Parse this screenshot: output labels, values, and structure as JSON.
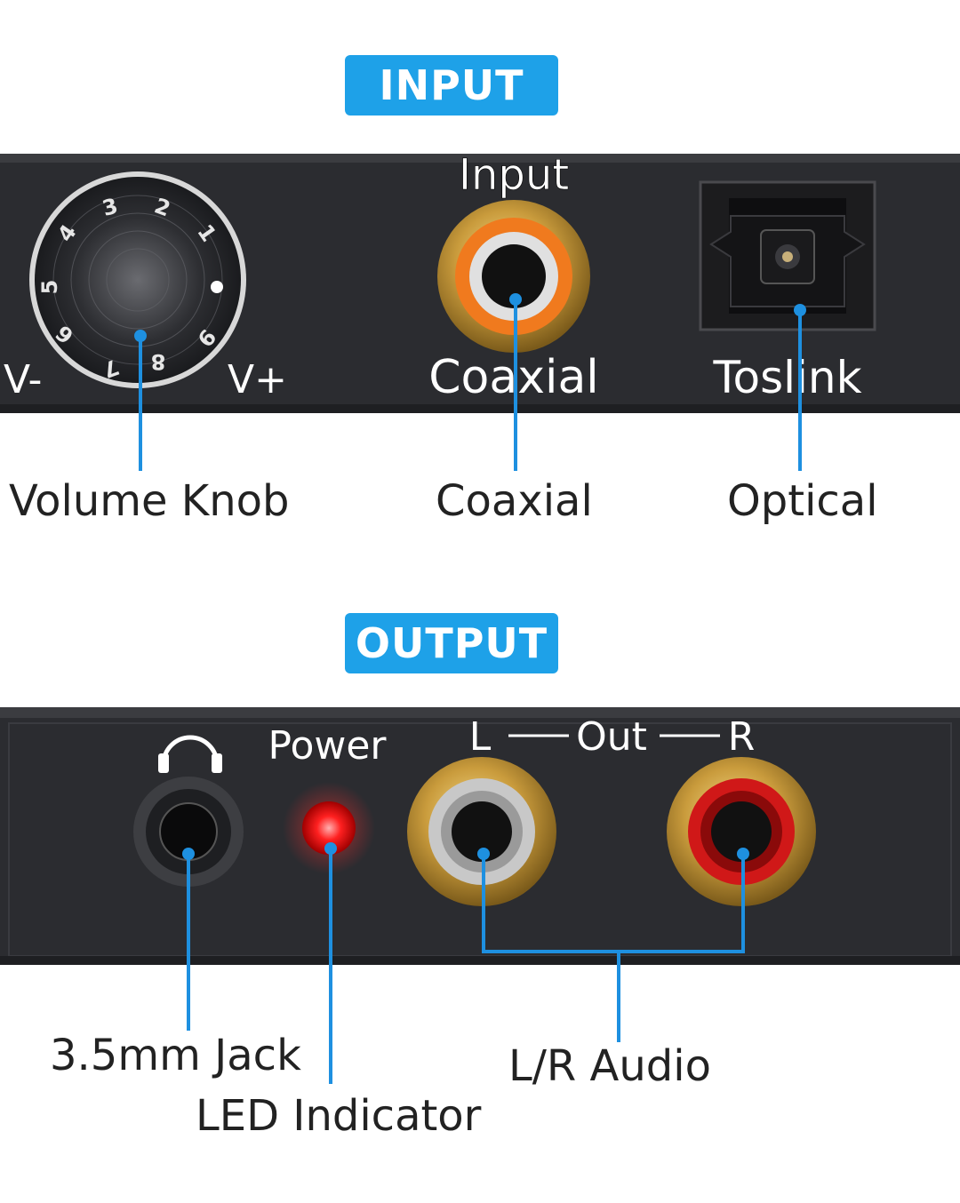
{
  "input_section": {
    "badge": "INPUT",
    "panel_labels": {
      "input": "Input",
      "coaxial": "Coaxial",
      "toslink": "Toslink",
      "v_minus": "V-",
      "v_plus": "V+"
    },
    "knob_numbers": [
      "1",
      "2",
      "3",
      "4",
      "5",
      "6",
      "7",
      "8",
      "9"
    ],
    "callouts": {
      "volume_knob": "Volume Knob",
      "coaxial": "Coaxial",
      "optical": "Optical"
    }
  },
  "output_section": {
    "badge": "OUTPUT",
    "panel_labels": {
      "power": "Power",
      "left": "L",
      "out": "Out",
      "right": "R"
    },
    "callouts": {
      "jack": "3.5mm Jack",
      "led": "LED Indicator",
      "lr_audio": "L/R Audio"
    }
  },
  "colors": {
    "accent_blue": "#1ea1e8",
    "panel_dark": "#2b2c30",
    "led_red": "#ff2020",
    "rca_red": "#d01818",
    "rca_white": "#c8c8c8",
    "coax_orange": "#f07a1e",
    "gold": "#c9a04a"
  }
}
